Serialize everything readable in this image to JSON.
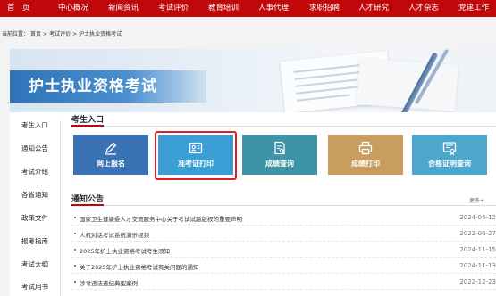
{
  "nav": {
    "items": [
      "首　页",
      "中心概况",
      "新闻资讯",
      "考试评价",
      "教育培训",
      "人事代理",
      "求职招聘",
      "人才研究",
      "人才杂志",
      "党建工作"
    ],
    "bg_color": "#c0080a"
  },
  "breadcrumb": {
    "prefix": "当前位置：",
    "parts": [
      "首页",
      ">",
      "考试评价",
      ">",
      "护士执业资格考试"
    ]
  },
  "banner": {
    "title": "护士执业资格考试"
  },
  "sidebar": {
    "items": [
      "考生入口",
      "通知公告",
      "考试介绍",
      "各省通知",
      "政策文件",
      "报考指南",
      "考试大纲",
      "考试用书"
    ]
  },
  "entry": {
    "title": "考生入口",
    "cards": [
      {
        "label": "网上报名",
        "icon": "pen-icon",
        "color": "#3a73b5"
      },
      {
        "label": "准考证打印",
        "icon": "id-card-icon",
        "color": "#3b9fd6"
      },
      {
        "label": "成绩查询",
        "icon": "document-search-icon",
        "color": "#3f93a6"
      },
      {
        "label": "成绩打印",
        "icon": "printer-icon",
        "color": "#c89d5e"
      },
      {
        "label": "合格证明查询",
        "icon": "certificate-icon",
        "color": "#4da7cc"
      }
    ],
    "highlighted": "准考证打印"
  },
  "notices": {
    "title": "通知公告",
    "more": "更多+",
    "items": [
      {
        "title": "国家卫生健康委人才交流服务中心关于考试试题版权的重要声明",
        "date": "2024-04-12"
      },
      {
        "title": "人机对话考试系统演示视频",
        "date": "2022-06-27"
      },
      {
        "title": "2025年护士执业资格考试考生须知",
        "date": "2024-11-15"
      },
      {
        "title": "关于2025年护士执业资格考试有关问题的通知",
        "date": "2024-11-13"
      },
      {
        "title": "涉考违法违纪典型案例",
        "date": "2022-12-23"
      }
    ]
  }
}
